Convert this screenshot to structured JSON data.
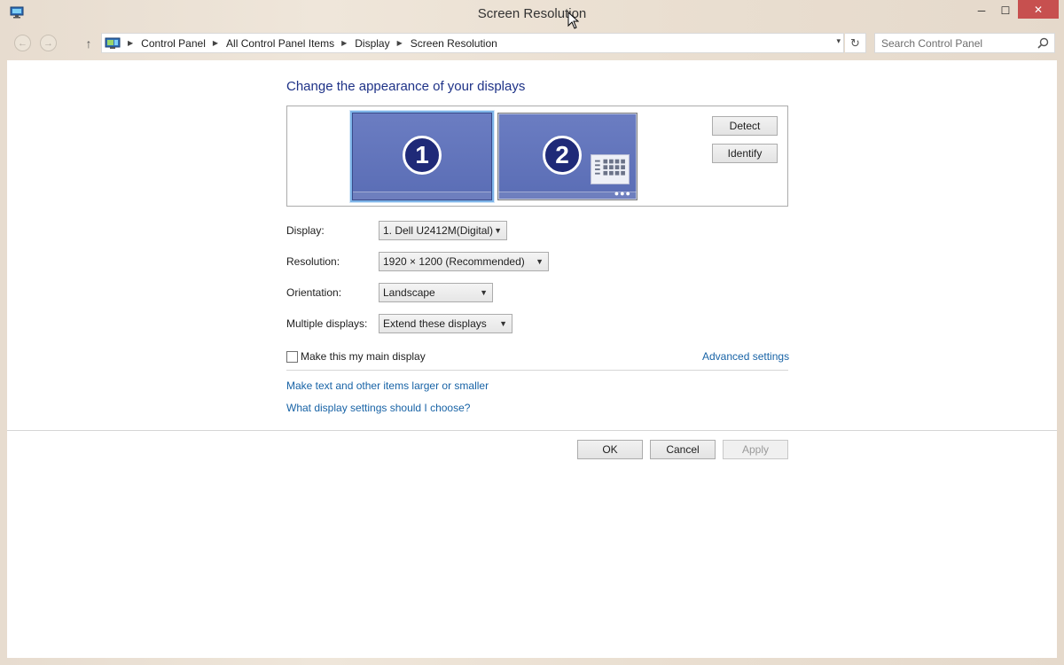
{
  "window": {
    "title": "Screen Resolution",
    "controls": {
      "minimize": "─",
      "maximize": "☐",
      "close": "✕"
    }
  },
  "nav": {
    "back_icon": "←",
    "forward_icon": "→",
    "up_icon": "↑",
    "breadcrumbs": [
      "Control Panel",
      "All Control Panel Items",
      "Display",
      "Screen Resolution"
    ],
    "dropdown_icon": "▾",
    "refresh_icon": "↻",
    "search_placeholder": "Search Control Panel"
  },
  "main": {
    "heading": "Change the appearance of your displays",
    "monitors": [
      {
        "number": "1",
        "selected": true
      },
      {
        "number": "2",
        "selected": false
      }
    ],
    "detect_label": "Detect",
    "identify_label": "Identify",
    "fields": {
      "display": {
        "label": "Display:",
        "value": "1. Dell U2412M(Digital)"
      },
      "resolution": {
        "label": "Resolution:",
        "value": "1920 × 1200 (Recommended)"
      },
      "orientation": {
        "label": "Orientation:",
        "value": "Landscape"
      },
      "multiple": {
        "label": "Multiple displays:",
        "value": "Extend these displays"
      }
    },
    "main_display_checkbox": {
      "label": "Make this my main display",
      "checked": false
    },
    "advanced_link": "Advanced settings",
    "links": [
      "Make text and other items larger or smaller",
      "What display settings should I choose?"
    ]
  },
  "footer": {
    "ok_label": "OK",
    "cancel_label": "Cancel",
    "apply_label": "Apply"
  },
  "colors": {
    "link": "#1863a6",
    "heading": "#1e3287",
    "close_button": "#c7504f",
    "monitor": "#5a6db5"
  }
}
